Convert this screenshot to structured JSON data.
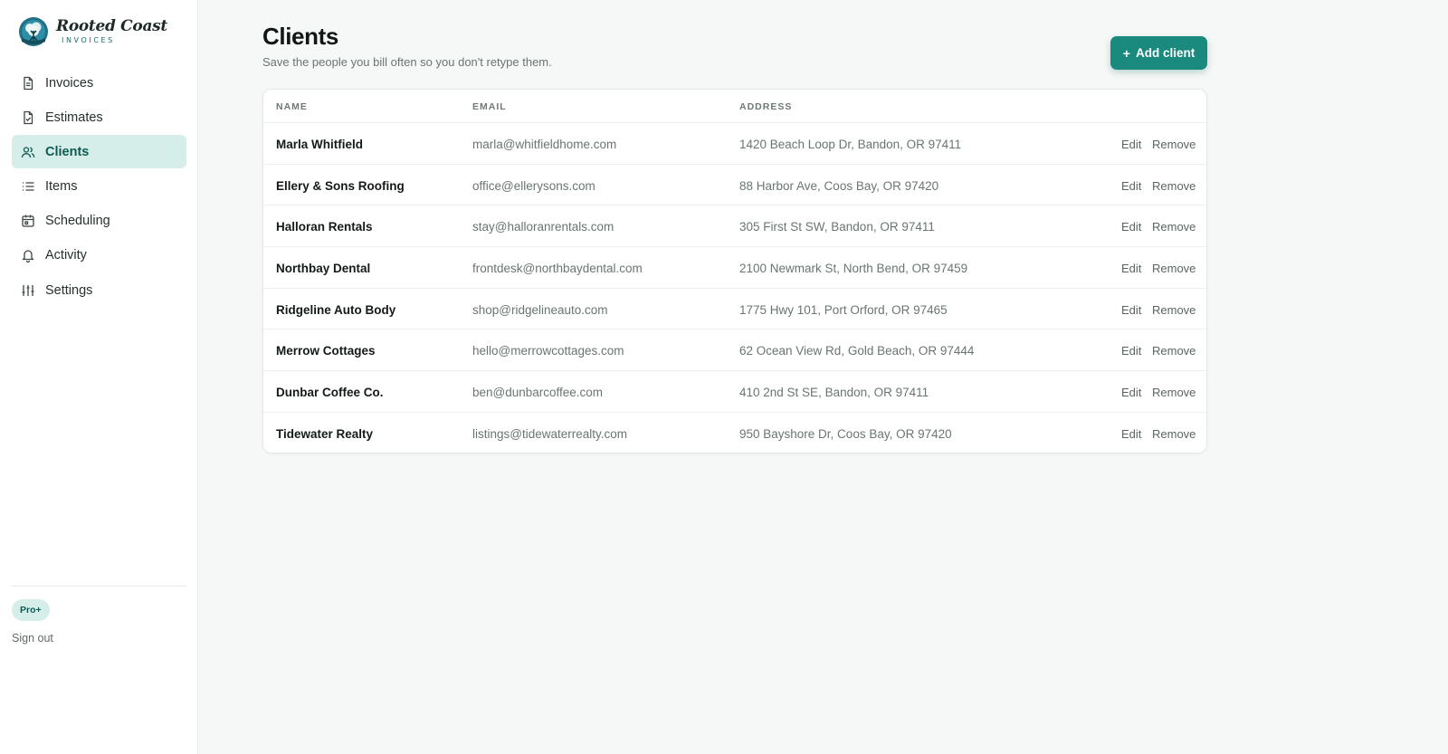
{
  "app": {
    "logo_script": "Rooted Coast",
    "logo_sub": "INVOICES"
  },
  "sidebar": {
    "items": [
      {
        "label": "Invoices",
        "icon": "file-icon"
      },
      {
        "label": "Estimates",
        "icon": "file-check-icon"
      },
      {
        "label": "Clients",
        "icon": "users-icon",
        "active": true
      },
      {
        "label": "Items",
        "icon": "list-icon"
      },
      {
        "label": "Scheduling",
        "icon": "calendar-icon"
      },
      {
        "label": "Activity",
        "icon": "bell-icon"
      },
      {
        "label": "Settings",
        "icon": "sliders-icon"
      }
    ],
    "plan_badge": "Pro+",
    "sign_out": "Sign out"
  },
  "header": {
    "title": "Clients",
    "subtitle": "Save the people you bill often so you don't retype them.",
    "add_button_icon": "+",
    "add_button_label": "Add client"
  },
  "table": {
    "columns": [
      "NAME",
      "EMAIL",
      "ADDRESS"
    ],
    "edit_label": "Edit",
    "remove_label": "Remove",
    "rows": [
      {
        "name": "Marla Whitfield",
        "email": "marla@whitfieldhome.com",
        "address": "1420 Beach Loop Dr, Bandon, OR 97411"
      },
      {
        "name": "Ellery & Sons Roofing",
        "email": "office@ellerysons.com",
        "address": "88 Harbor Ave, Coos Bay, OR 97420"
      },
      {
        "name": "Halloran Rentals",
        "email": "stay@halloranrentals.com",
        "address": "305 First St SW, Bandon, OR 97411"
      },
      {
        "name": "Northbay Dental",
        "email": "frontdesk@northbaydental.com",
        "address": "2100 Newmark St, North Bend, OR 97459"
      },
      {
        "name": "Ridgeline Auto Body",
        "email": "shop@ridgelineauto.com",
        "address": "1775 Hwy 101, Port Orford, OR 97465"
      },
      {
        "name": "Merrow Cottages",
        "email": "hello@merrowcottages.com",
        "address": "62 Ocean View Rd, Gold Beach, OR 97444"
      },
      {
        "name": "Dunbar Coffee Co.",
        "email": "ben@dunbarcoffee.com",
        "address": "410 2nd St SE, Bandon, OR 97411"
      },
      {
        "name": "Tidewater Realty",
        "email": "listings@tidewaterrealty.com",
        "address": "950 Bayshore Dr, Coos Bay, OR 97420"
      }
    ]
  },
  "colors": {
    "accent": "#1a8a7e",
    "active_bg": "#d5eee9",
    "active_text": "#0f5a52"
  }
}
